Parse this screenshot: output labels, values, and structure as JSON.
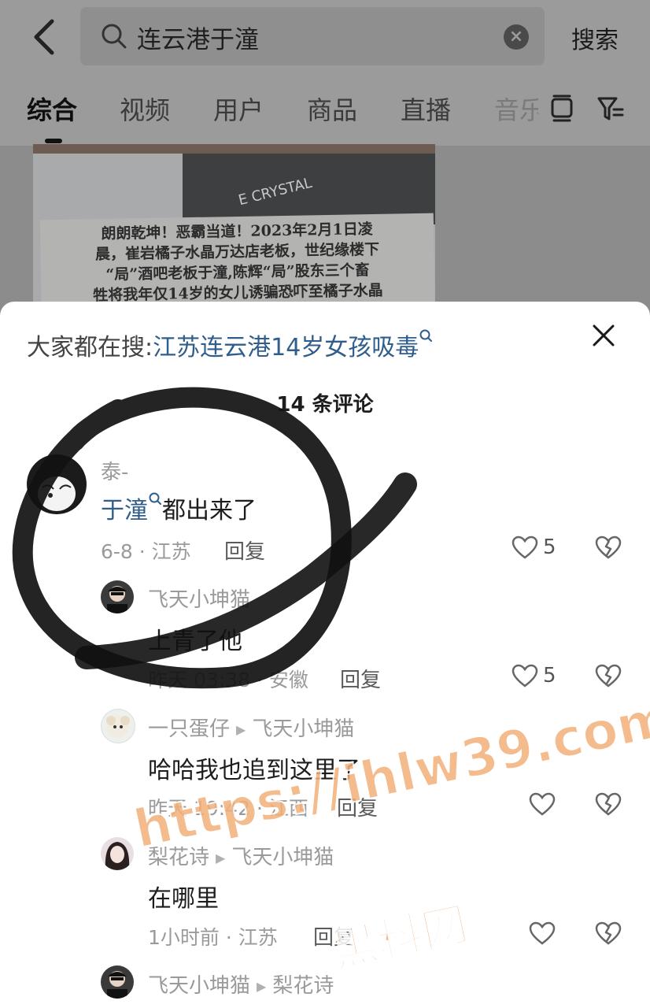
{
  "header": {
    "search_query": "连云港于潼",
    "search_button": "搜索"
  },
  "tabs": [
    {
      "label": "综合"
    },
    {
      "label": "视频"
    },
    {
      "label": "用户"
    },
    {
      "label": "商品"
    },
    {
      "label": "直播"
    },
    {
      "label": "音乐"
    }
  ],
  "video_thumb": {
    "sign_lines": [
      "朗朗乾坤！恶霸当道！2023年2月1日凌",
      "晨，崔岩橘子水晶万达店老板，世纪缘楼下",
      "“局”酒吧老板于潼,陈辉“局”股东三个畜",
      "牲将我年仅14岁的女儿诱骗恐吓至橘子水晶"
    ],
    "sign_brand": "E CRYSTAL"
  },
  "sheet": {
    "trending_prefix": "大家都在搜:",
    "trending_keyword": "江苏连云港14岁女孩吸毒",
    "comment_count": "14 条评论"
  },
  "comments": [
    {
      "user": "泰-",
      "text_link": "于潼",
      "text": "都出来了",
      "meta": "6-8 · 江苏",
      "reply": "回复",
      "likes": "5"
    },
    {
      "user": "飞天小坤猫",
      "text": "上青了他",
      "meta": "昨天 03:38 · 安徽",
      "reply": "回复",
      "likes": "5"
    },
    {
      "user": "一只蛋仔",
      "reply_to": "飞天小坤猫",
      "text": "哈哈我也追到这里了",
      "meta": "昨天 19:42 · 江西",
      "reply": "回复"
    },
    {
      "user": "梨花诗",
      "reply_to": "飞天小坤猫",
      "text": "在哪里",
      "meta": "1小时前 · 江苏",
      "reply": "回复"
    },
    {
      "user": "飞天小坤猫",
      "reply_to": "梨花诗"
    }
  ],
  "watermark": {
    "url": "https://ihlw39.com",
    "site": "黑料网"
  }
}
